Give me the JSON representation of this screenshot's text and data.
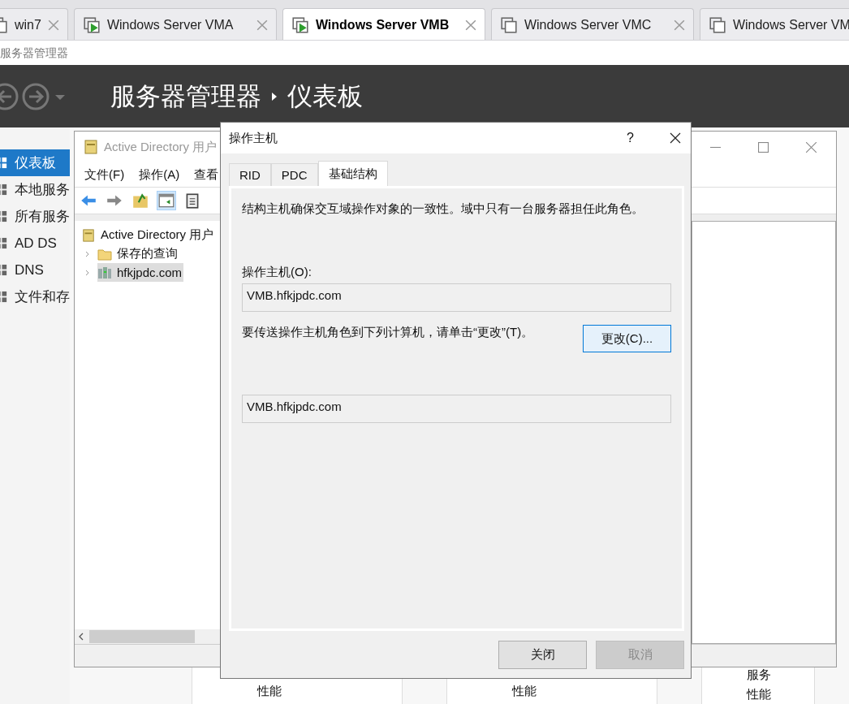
{
  "browser_tabs": [
    {
      "label": "win7",
      "selected": false,
      "running": false
    },
    {
      "label": "Windows Server VMA",
      "selected": false,
      "running": true
    },
    {
      "label": "Windows Server VMB",
      "selected": true,
      "running": true
    },
    {
      "label": "Windows Server VMC",
      "selected": false,
      "running": false
    },
    {
      "label": "Windows Server VM",
      "selected": false,
      "running": false
    }
  ],
  "app_caption": "服务器管理器",
  "header": {
    "title": "服务器管理器",
    "page": "仪表板"
  },
  "sidebar": {
    "items": [
      {
        "label": "仪表板",
        "selected": true
      },
      {
        "label": "本地服务",
        "selected": false
      },
      {
        "label": "所有服务",
        "selected": false
      },
      {
        "label": "AD DS",
        "selected": false
      },
      {
        "label": "DNS",
        "selected": false
      },
      {
        "label": "文件和存",
        "selected": false
      }
    ]
  },
  "tiles": [
    {
      "lines": [
        "性能"
      ]
    },
    {
      "lines": [
        "性能"
      ]
    },
    {
      "lines": [
        "服务",
        "性能"
      ]
    }
  ],
  "ad_window": {
    "title": "Active Directory 用户",
    "menu": [
      "文件(F)",
      "操作(A)",
      "查看"
    ],
    "tree": [
      {
        "label": "Active Directory 用户",
        "children": [
          {
            "label": "保存的查询",
            "kind": "folder",
            "expanded": false,
            "selected": false
          },
          {
            "label": "hfkjpdc.com",
            "kind": "domain",
            "expanded": false,
            "selected": true
          }
        ]
      }
    ]
  },
  "dialog": {
    "title": "操作主机",
    "help": "?",
    "tabs": [
      {
        "label": "RID",
        "selected": false
      },
      {
        "label": "PDC",
        "selected": false
      },
      {
        "label": "基础结构",
        "selected": true
      }
    ],
    "description": "结构主机确保交互域操作对象的一致性。域中只有一台服务器担任此角色。",
    "owner_label": "操作主机(O):",
    "owner_value": "VMB.hfkjpdc.com",
    "transfer_text": "要传送操作主机角色到下列计算机，请单击“更改”(T)。",
    "change_button": "更改(C)...",
    "target_value": "VMB.hfkjpdc.com",
    "buttons": [
      {
        "label": "关闭",
        "disabled": false
      },
      {
        "label": "取消",
        "disabled": true
      }
    ]
  }
}
